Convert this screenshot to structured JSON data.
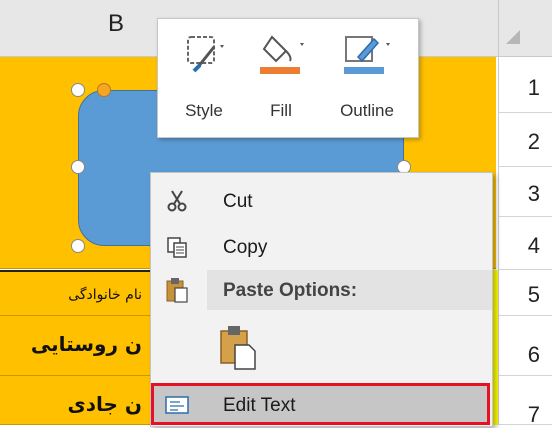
{
  "sheet": {
    "column_label": "B",
    "rows": [
      "1",
      "2",
      "3",
      "4",
      "5",
      "6",
      "7"
    ],
    "cells": {
      "row5_text": "نام خانوادگی",
      "row6_text": "ن روستایی",
      "row7_text": "ن جادی"
    }
  },
  "mini_toolbar": {
    "style_label": "Style",
    "fill_label": "Fill",
    "outline_label": "Outline"
  },
  "context_menu": {
    "cut_label": "Cut",
    "copy_label": "Copy",
    "paste_options_label": "Paste Options:",
    "edit_text_label": "Edit Text"
  },
  "colors": {
    "cell_fill": "#ffc000",
    "shape_fill": "#5b9bd5",
    "fill_accent": "#ed7d31",
    "outline_accent": "#5b9bd5",
    "highlight_border": "#e81123"
  }
}
